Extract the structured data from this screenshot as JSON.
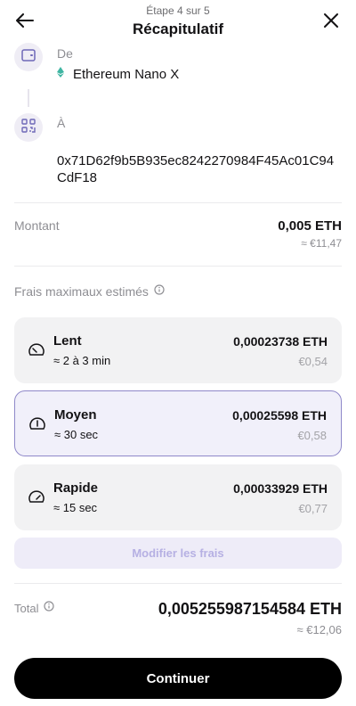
{
  "header": {
    "step": "Étape 4 sur 5",
    "title": "Récapitulatif",
    "back_icon": "arrow-left-icon",
    "close_icon": "close-icon"
  },
  "from": {
    "label": "De",
    "icon": "wallet-icon",
    "device_icon": "ethereum-icon",
    "device_name": "Ethereum Nano X"
  },
  "to": {
    "label": "À",
    "icon": "qr-code-icon",
    "address": "0x71D62f9b5B935ec8242270984F45Ac01C94CdF18"
  },
  "amount": {
    "label": "Montant",
    "value": "0,005 ETH",
    "fiat": "≈ €11,47"
  },
  "fees": {
    "label": "Frais maximaux estimés",
    "info_icon": "info-icon",
    "options": [
      {
        "name": "Lent",
        "time": "≈ 2 à 3 min",
        "amount": "0,00023738 ETH",
        "fiat": "€0,54",
        "icon": "speedometer-slow-icon",
        "selected": false
      },
      {
        "name": "Moyen",
        "time": "≈ 30 sec",
        "amount": "0,00025598 ETH",
        "fiat": "€0,58",
        "icon": "speedometer-medium-icon",
        "selected": true
      },
      {
        "name": "Rapide",
        "time": "≈ 15 sec",
        "amount": "0,00033929 ETH",
        "fiat": "€0,77",
        "icon": "speedometer-fast-icon",
        "selected": false
      }
    ],
    "modify_label": "Modifier les frais"
  },
  "total": {
    "label": "Total",
    "info_icon": "info-icon",
    "value": "0,005255987154584 ETH",
    "fiat": "≈ €12,06"
  },
  "continue_label": "Continuer",
  "colors": {
    "accent": "#8f88c9",
    "accent_light": "#f1f0fa",
    "button": "#000000"
  }
}
